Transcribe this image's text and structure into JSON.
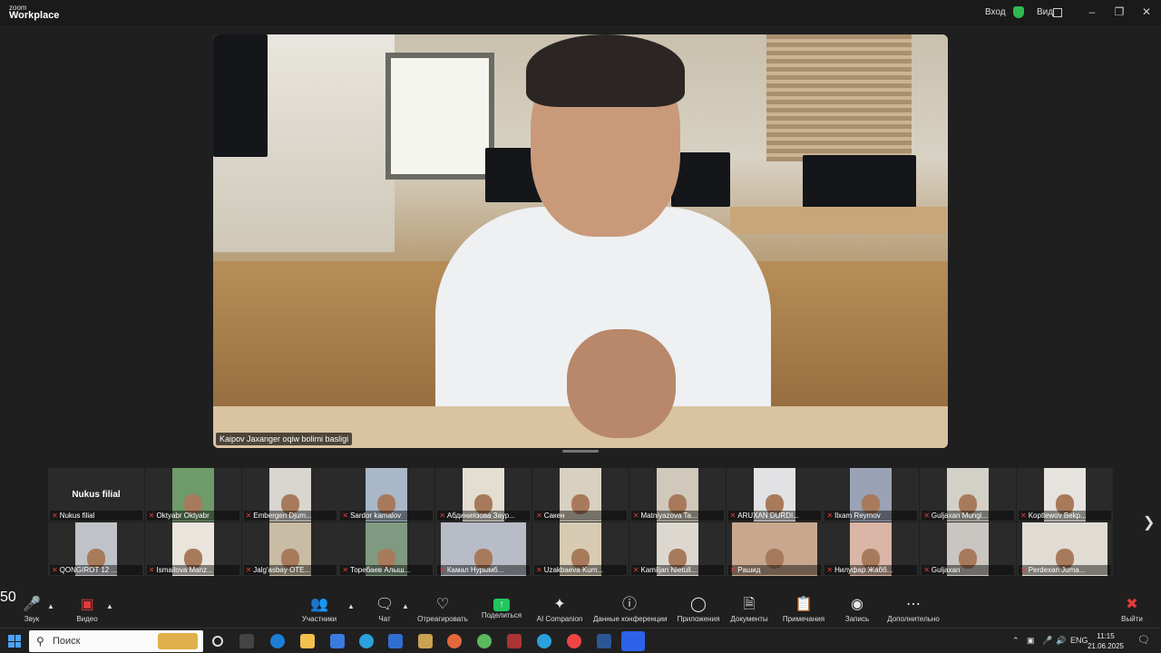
{
  "app": {
    "logo_top": "zoom",
    "logo_bottom": "Workplace",
    "signin": "Вход",
    "view": "Вид"
  },
  "main_video": {
    "speaker_name": "Kaipov Jaxanger oqiw bolimi basligi"
  },
  "gallery": [
    {
      "name": "Nukus filial",
      "big": "Nukus filial",
      "color": "#2a2a2a"
    },
    {
      "name": "Oktyabr Oktyabr",
      "color": "#6f9a6a"
    },
    {
      "name": "Embergen Djum...",
      "color": "#d9d6cf"
    },
    {
      "name": "Sardor kamalov",
      "color": "#a8b8c8"
    },
    {
      "name": "Абдиниязова Заур...",
      "color": "#e3ddd2"
    },
    {
      "name": "Сакен",
      "color": "#d8d0c0"
    },
    {
      "name": "Matniyazova Ta...",
      "color": "#cfc8bb"
    },
    {
      "name": "ARUXAN DURDI...",
      "color": "#e2e2e4"
    },
    {
      "name": "Ilxam Reymov",
      "color": "#9aa3b5"
    },
    {
      "name": "Guljaxan Mungi...",
      "color": "#d3d0c8"
    },
    {
      "name": "Koptlewov Bekp...",
      "color": "#e6e3de"
    },
    {
      "name": "QONGIROT 12 ...",
      "color": "#bfc3c8"
    },
    {
      "name": "Ismailova Manz...",
      "color": "#e9e4dc"
    },
    {
      "name": "Jalg'asbay OTE...",
      "color": "#c8bca5"
    },
    {
      "name": "Торебаев Алыш...",
      "color": "#7f9a80"
    },
    {
      "name": "Камал Нурымб...",
      "color": "#b8bcc6",
      "wide": true
    },
    {
      "name": "Uzakbaeva Kum...",
      "color": "#d8cbb4"
    },
    {
      "name": "Kamiljan Nietull...",
      "color": "#dcd8d0"
    },
    {
      "name": "Рашид",
      "color": "#c7a88e",
      "wide": true
    },
    {
      "name": "Нилуфар Жабб...",
      "color": "#d9b6a6"
    },
    {
      "name": "Guljaxan",
      "color": "#c9c5c0"
    },
    {
      "name": "Perdexan Juma...",
      "color": "#e1dcd3",
      "wide": true
    }
  ],
  "toolbar": {
    "audio": "Звук",
    "video": "Видео",
    "participants": "Участники",
    "participants_count": "50",
    "chat": "Чат",
    "react": "Отреагировать",
    "share": "Поделиться",
    "ai": "AI Companion",
    "meeting_info": "Данные конференции",
    "apps": "Приложения",
    "docs": "Документы",
    "notes": "Примечания",
    "record": "Запись",
    "more": "Дополнительно",
    "leave": "Выйти"
  },
  "taskbar": {
    "search_placeholder": "Поиск",
    "lang": "ENG",
    "time": "11:15",
    "date": "21.06.2025"
  },
  "colors": {
    "share_green": "#22c55e",
    "muted_red": "#e23b3b",
    "secure_green": "#2fb84f"
  }
}
